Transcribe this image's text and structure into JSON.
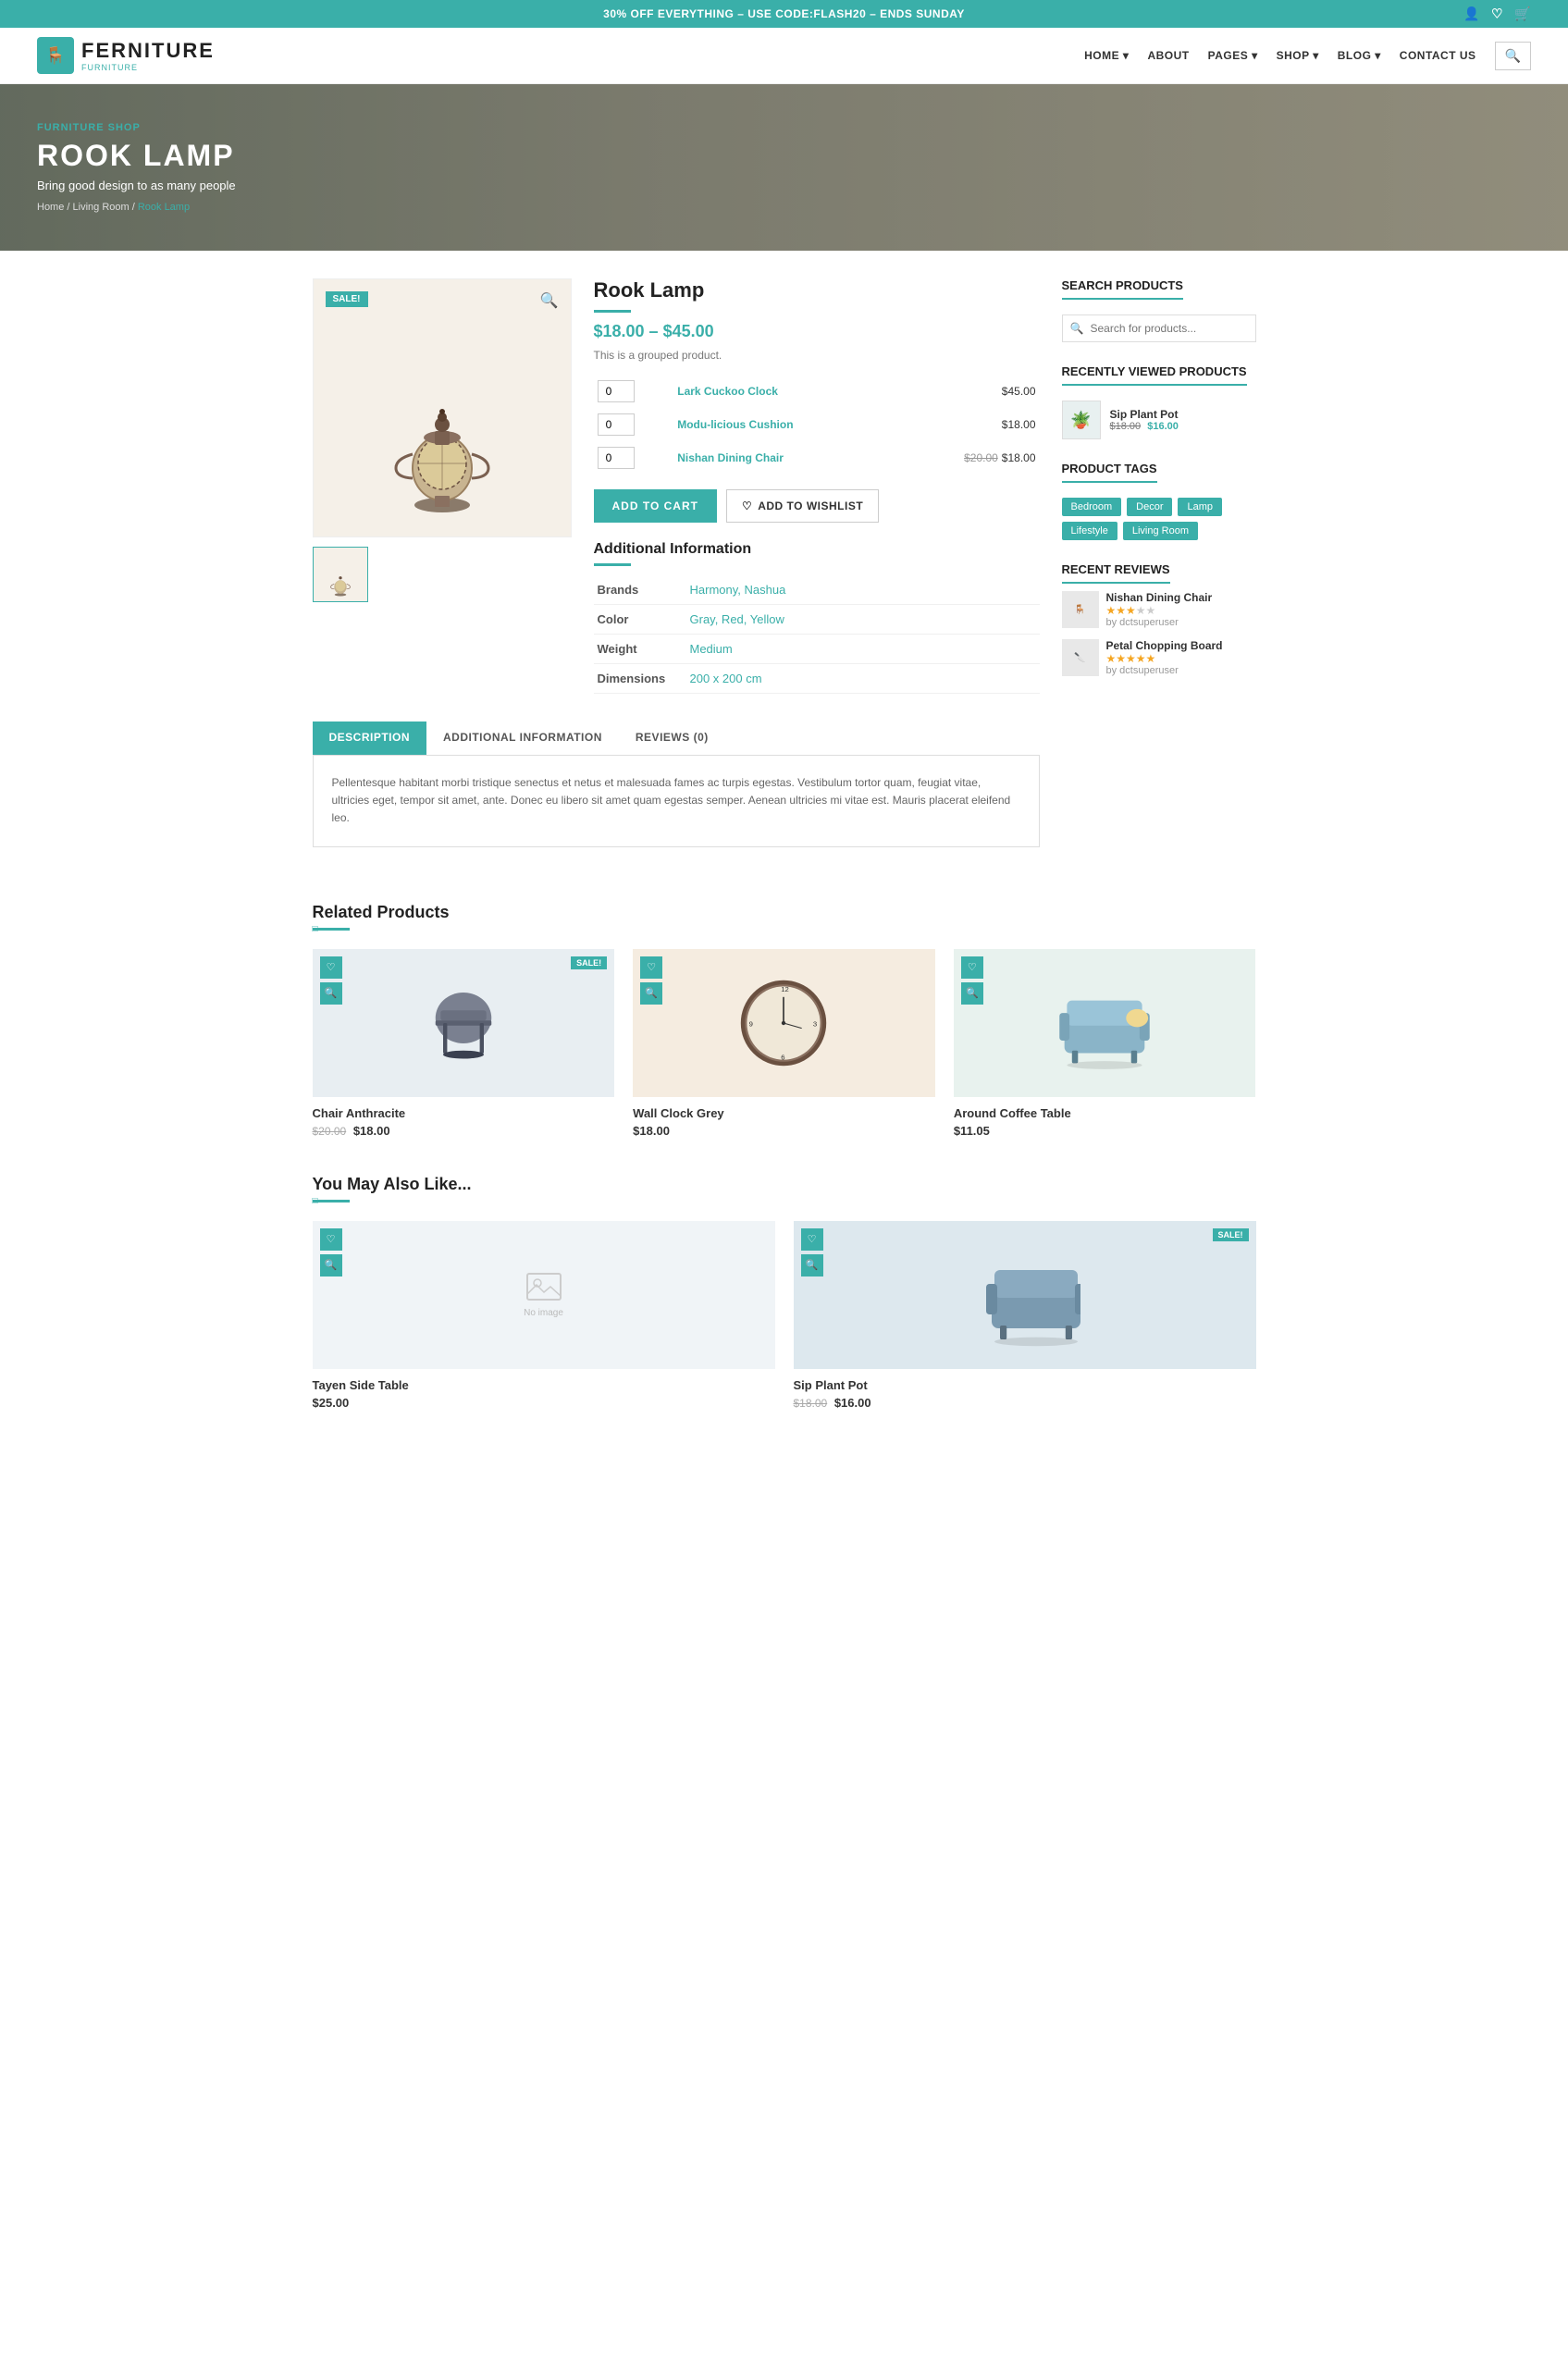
{
  "banner": {
    "text": "30% OFF EVERYTHING – USE CODE:FLASH20 – ENDS SUNDAY"
  },
  "header": {
    "logo_text": "FERNITURE",
    "logo_sub": "FURNITURE",
    "nav": [
      {
        "label": "HOME",
        "has_dropdown": true
      },
      {
        "label": "ABOUT",
        "has_dropdown": false
      },
      {
        "label": "PAGES",
        "has_dropdown": true
      },
      {
        "label": "SHOP",
        "has_dropdown": true
      },
      {
        "label": "BLOG",
        "has_dropdown": true
      },
      {
        "label": "CONTACT US",
        "has_dropdown": false
      }
    ]
  },
  "hero": {
    "shop_label": "FURNITURE SHOP",
    "title": "ROOK LAMP",
    "subtitle": "Bring good design to as many people",
    "breadcrumb": [
      "Home",
      "Living Room",
      "Rook Lamp"
    ]
  },
  "product": {
    "title": "Rook Lamp",
    "sale_badge": "SALE!",
    "price_range": "$18.00 – $45.00",
    "grouped_label": "This is a grouped product.",
    "items": [
      {
        "qty": "0",
        "name": "Lark Cuckoo Clock",
        "price": "$45.00",
        "old_price": ""
      },
      {
        "qty": "0",
        "name": "Modu-licious Cushion",
        "price": "$18.00",
        "old_price": ""
      },
      {
        "qty": "0",
        "name": "Nishan Dining Chair",
        "price": "$18.00",
        "old_price": "$20.00"
      }
    ],
    "add_to_cart": "ADD TO CART",
    "add_to_wishlist": "ADD TO WISHLIST",
    "additional_info_title": "Additional Information",
    "attributes": [
      {
        "label": "Brands",
        "value": "Harmony, Nashua"
      },
      {
        "label": "Color",
        "value": "Gray, Red, Yellow"
      },
      {
        "label": "Weight",
        "value": "Medium"
      },
      {
        "label": "Dimensions",
        "value": "200 x 200 cm"
      }
    ]
  },
  "tabs": [
    {
      "label": "DESCRIPTION",
      "active": true
    },
    {
      "label": "ADDITIONAL INFORMATION",
      "active": false
    },
    {
      "label": "REVIEWS (0)",
      "active": false
    }
  ],
  "tab_content": "Pellentesque habitant morbi tristique senectus et netus et malesuada fames ac turpis egestas. Vestibulum tortor quam, feugiat vitae, ultricies eget, tempor sit amet, ante. Donec eu libero sit amet quam egestas semper. Aenean ultricies mi vitae est. Mauris placerat eleifend leo.",
  "sidebar": {
    "search_title": "SEARCH PRODUCTS",
    "search_placeholder": "Search for products...",
    "recently_viewed_title": "RECENTLY VIEWED PRODUCTS",
    "recently_viewed": [
      {
        "name": "Sip Plant Pot",
        "old_price": "$18.00",
        "new_price": "$16.00",
        "emoji": "🪴"
      }
    ],
    "tags_title": "PRODUCT TAGS",
    "tags": [
      "Bedroom",
      "Decor",
      "Lamp",
      "Lifestyle",
      "Living Room"
    ],
    "reviews_title": "RECENT REVIEWS",
    "reviews": [
      {
        "name": "Nishan Dining Chair",
        "stars": 3,
        "by": "by dctsuperuser",
        "emoji": "🪑"
      },
      {
        "name": "Petal Chopping Board",
        "stars": 5,
        "by": "by dctsuperuser",
        "emoji": "🔪"
      }
    ]
  },
  "related_products": {
    "title": "Related Products",
    "items": [
      {
        "name": "Chair Anthracite",
        "old_price": "$20.00",
        "new_price": "$18.00",
        "sale": true,
        "emoji": "🪑",
        "bg": "#e8eef2"
      },
      {
        "name": "Wall Clock Grey",
        "old_price": "",
        "new_price": "$18.00",
        "sale": false,
        "emoji": "🕐",
        "bg": "#f5ece0"
      },
      {
        "name": "Around Coffee Table",
        "old_price": "",
        "new_price": "$11.05",
        "sale": false,
        "emoji": "🪑",
        "bg": "#e8f2ee"
      }
    ]
  },
  "also_like": {
    "title": "You May Also Like...",
    "items": [
      {
        "name": "Tayen Side Table",
        "old_price": "",
        "new_price": "$25.00",
        "sale": false,
        "placeholder": true
      },
      {
        "name": "Sip Plant Pot",
        "old_price": "$18.00",
        "new_price": "$16.00",
        "sale": true,
        "placeholder": false,
        "emoji": "🪑",
        "bg": "#dde8ee"
      }
    ]
  }
}
